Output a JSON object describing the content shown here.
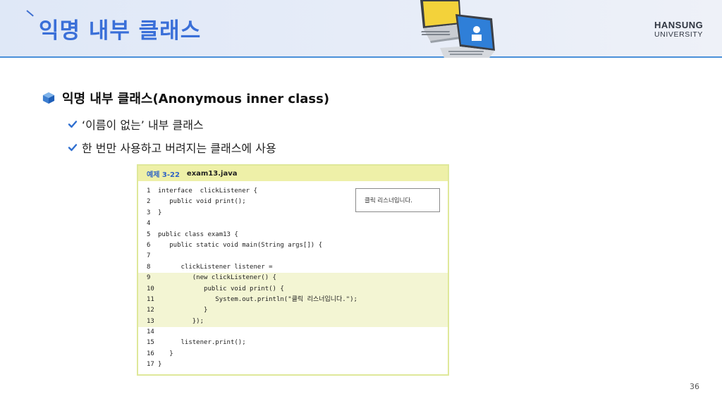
{
  "header": {
    "title": "익명 내부 클래스",
    "logo_line1": "HANSUNG",
    "logo_line2": "UNIVERSITY"
  },
  "bullets": {
    "main": "익명 내부 클래스(Anonymous inner class)",
    "sub": [
      "‘이름이 없는’ 내부 클래스",
      "한 번만 사용하고 버려지는 클래스에 사용"
    ]
  },
  "code_example": {
    "label": "예제 3-22",
    "filename": "exam13.java",
    "output": "클릭 리스너입니다.",
    "lines": [
      {
        "n": "1",
        "code": "interface  clickListener {",
        "hl": false
      },
      {
        "n": "2",
        "code": "   public void print();",
        "hl": false
      },
      {
        "n": "3",
        "code": "}",
        "hl": false
      },
      {
        "n": "4",
        "code": "",
        "hl": false
      },
      {
        "n": "5",
        "code": "public class exam13 {",
        "hl": false
      },
      {
        "n": "6",
        "code": "   public static void main(String args[]) {",
        "hl": false
      },
      {
        "n": "7",
        "code": "",
        "hl": false
      },
      {
        "n": "8",
        "code": "      clickListener listener =",
        "hl": false
      },
      {
        "n": "9",
        "code": "         (new clickListener() {",
        "hl": true
      },
      {
        "n": "10",
        "code": "            public void print() {",
        "hl": true
      },
      {
        "n": "11",
        "code": "               System.out.println(\"클릭 리스너입니다.\");",
        "hl": true
      },
      {
        "n": "12",
        "code": "            }",
        "hl": true
      },
      {
        "n": "13",
        "code": "         });",
        "hl": true
      },
      {
        "n": "14",
        "code": "",
        "hl": false
      },
      {
        "n": "15",
        "code": "      listener.print();",
        "hl": false
      },
      {
        "n": "16",
        "code": "   }",
        "hl": false
      },
      {
        "n": "17",
        "code": "}",
        "hl": false
      }
    ]
  },
  "page_number": "36",
  "colors": {
    "title": "#3a6fd8",
    "header_rule": "#4a90d9",
    "code_header_bg": "#eef0a8",
    "highlight_bg": "#f3f5d3"
  },
  "icons": {
    "bullet": "cube-icon",
    "sub_bullet": "checkmark-icon",
    "illustration": "laptops-illustration"
  }
}
